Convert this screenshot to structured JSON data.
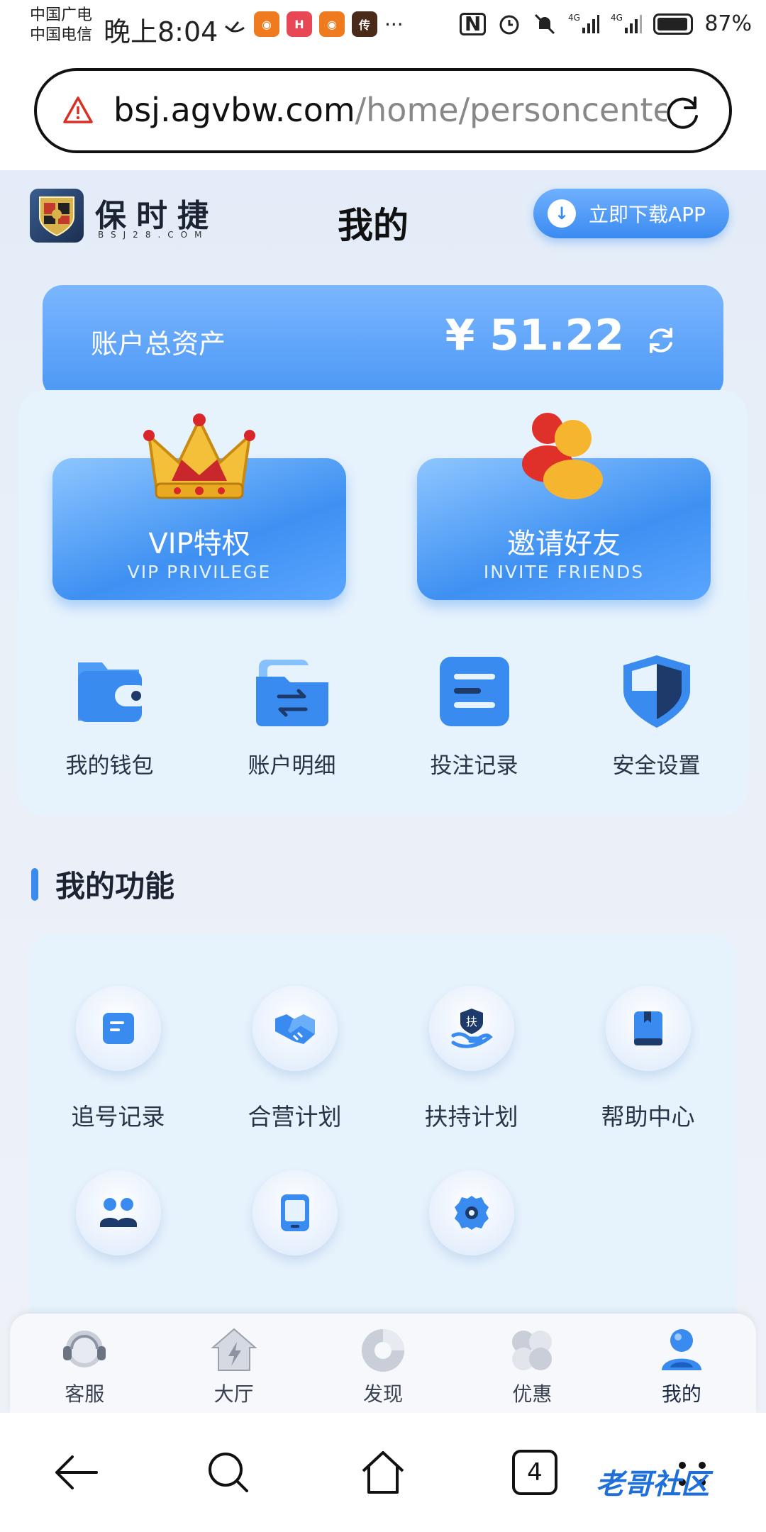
{
  "status_bar": {
    "carrier_1": "中国广电",
    "carrier_2": "中国电信",
    "time": "晚上8:04",
    "ellipsis": "···",
    "battery": "87%"
  },
  "browser": {
    "url_host": "bsj.agvbw.com",
    "url_path": "/home/personcente"
  },
  "header": {
    "brand": "保时捷",
    "brand_sub": "BSJ28.COM",
    "title": "我的",
    "download_label": "立即下载APP"
  },
  "asset": {
    "label": "账户总资产",
    "value": "¥ 51.22"
  },
  "features": [
    {
      "title": "VIP特权",
      "subtitle": "VIP PRIVILEGE"
    },
    {
      "title": "邀请好友",
      "subtitle": "INVITE FRIENDS"
    }
  ],
  "quick_actions": [
    {
      "label": "我的钱包",
      "icon": "wallet-icon"
    },
    {
      "label": "账户明细",
      "icon": "folder-transfer-icon"
    },
    {
      "label": "投注记录",
      "icon": "document-list-icon"
    },
    {
      "label": "安全设置",
      "icon": "shield-icon"
    }
  ],
  "section": {
    "title": "我的功能"
  },
  "functions": [
    {
      "label": "追号记录",
      "icon": "note-icon"
    },
    {
      "label": "合营计划",
      "icon": "handshake-icon"
    },
    {
      "label": "扶持计划",
      "icon": "support-hand-icon"
    },
    {
      "label": "帮助中心",
      "icon": "book-icon"
    },
    {
      "label": "",
      "icon": "users-icon"
    },
    {
      "label": "",
      "icon": "tablet-icon"
    },
    {
      "label": "",
      "icon": "settings-gear-icon"
    }
  ],
  "bottom_nav": [
    {
      "label": "客服",
      "icon": "headset-icon"
    },
    {
      "label": "大厅",
      "icon": "home-lightning-icon"
    },
    {
      "label": "发现",
      "icon": "disc-icon"
    },
    {
      "label": "优惠",
      "icon": "clover-icon"
    },
    {
      "label": "我的",
      "icon": "user-icon",
      "active": true
    }
  ],
  "system_nav": {
    "tab_count": "4"
  },
  "watermark": "老哥社区",
  "colors": {
    "accent": "#3a8bf0",
    "card_bg": "#e6f2fc"
  }
}
